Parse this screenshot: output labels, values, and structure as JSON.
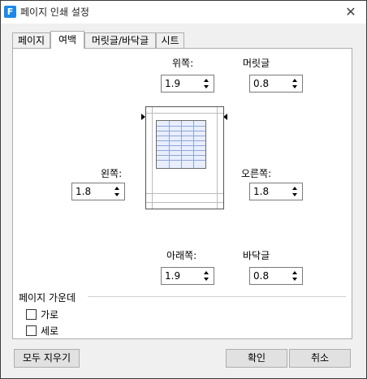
{
  "window": {
    "app_icon_letter": "F",
    "title": "페이지 인쇄 설정",
    "close_glyph": "✕"
  },
  "tabs": [
    {
      "label": "페이지",
      "active": false
    },
    {
      "label": "여백",
      "active": true
    },
    {
      "label": "머릿글/바닥글",
      "active": false
    },
    {
      "label": "시트",
      "active": false
    }
  ],
  "margins": {
    "top": {
      "label": "위쪽:",
      "value": "1.9"
    },
    "header": {
      "label": "머릿글",
      "value": "0.8"
    },
    "left": {
      "label": "왼쪽:",
      "value": "1.8"
    },
    "right": {
      "label": "오른쪽:",
      "value": "1.8"
    },
    "bottom": {
      "label": "아래쪽:",
      "value": "1.9"
    },
    "footer": {
      "label": "바닥글",
      "value": "0.8"
    }
  },
  "center_on_page": {
    "title": "페이지 가운데",
    "horizontal": {
      "label": "가로",
      "checked": false
    },
    "vertical": {
      "label": "세로",
      "checked": false
    }
  },
  "buttons": {
    "clear_all": "모두 지우기",
    "ok": "확인",
    "cancel": "취소"
  },
  "colors": {
    "accent": "#1e88e5",
    "preview_grid_fill": "#e8eefc"
  }
}
